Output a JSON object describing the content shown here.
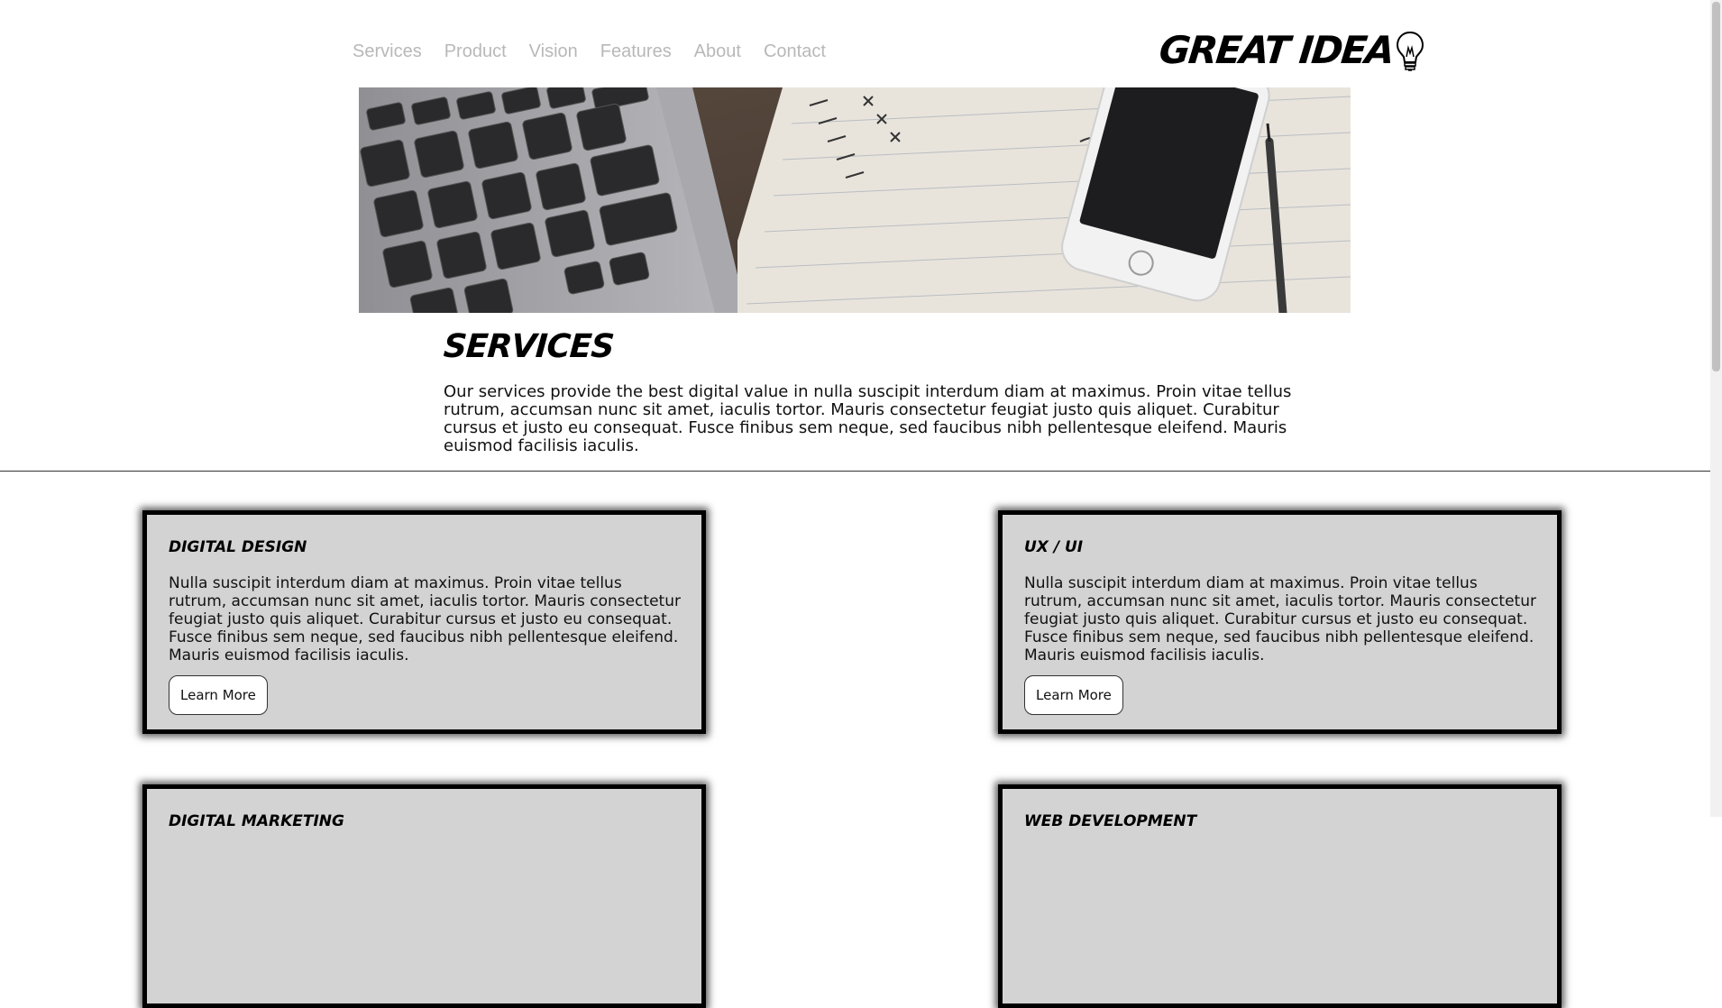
{
  "nav": {
    "items": [
      "Services",
      "Product",
      "Vision",
      "Features",
      "About",
      "Contact"
    ]
  },
  "brand": {
    "name": "GREAT IDEA"
  },
  "hero": {
    "alt": ""
  },
  "services": {
    "title": "SERVICES",
    "intro": "Our services provide the best digital value in nulla suscipit interdum diam at maximus. Proin vitae tellus rutrum, accumsan nunc sit amet, iaculis tortor. Mauris consectetur feugiat justo quis aliquet. Curabitur cursus et justo eu consequat. Fusce finibus sem neque, sed faucibus nibh pellentesque eleifend. Mauris euismod facilisis iaculis."
  },
  "cards": [
    {
      "title": "Digital Design",
      "body": "Nulla suscipit interdum diam at maximus. Proin vitae tellus rutrum, accumsan nunc sit amet, iaculis tortor. Mauris consectetur feugiat justo quis aliquet. Curabitur cursus et justo eu consequat. Fusce finibus sem neque, sed faucibus nibh pellentesque eleifend. Mauris euismod facilisis iaculis.",
      "button": "Learn More"
    },
    {
      "title": "UX / UI",
      "body": "Nulla suscipit interdum diam at maximus. Proin vitae tellus rutrum, accumsan nunc sit amet, iaculis tortor. Mauris consectetur feugiat justo quis aliquet. Curabitur cursus et justo eu consequat. Fusce finibus sem neque, sed faucibus nibh pellentesque eleifend. Mauris euismod facilisis iaculis.",
      "button": "Learn More"
    },
    {
      "title": "Digital Marketing"
    },
    {
      "title": "Web Development"
    }
  ],
  "colors": {
    "nav_text": "#b8b8b8",
    "card_bg": "#d3d3d3",
    "card_border": "#000000"
  }
}
